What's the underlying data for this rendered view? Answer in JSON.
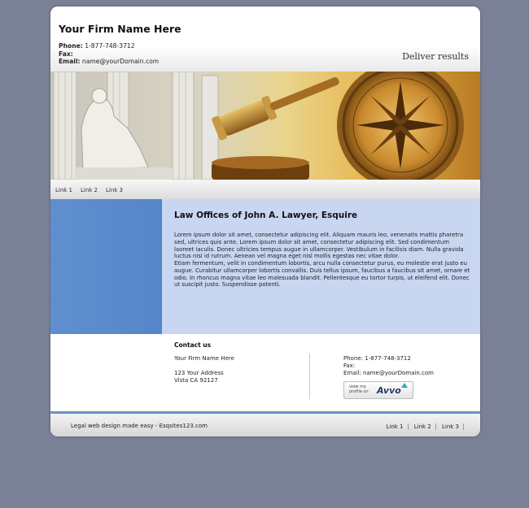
{
  "header": {
    "firm_name": "Your Firm Name Here",
    "phone_label": "Phone:",
    "phone_value": "1-877-748-3712",
    "fax_label": "Fax:",
    "email_label": "Email:",
    "email_value": "name@yourDomain.com",
    "tagline": "Deliver results"
  },
  "nav": {
    "links": [
      "Link 1",
      "Link 2",
      "Link 3"
    ]
  },
  "content": {
    "heading": "Law Offices of John A. Lawyer, Esquire",
    "paragraph1": "Lorem ipsum dolor sit amet, consectetur adipiscing elit. Aliquam mauris leo, venenatis mattis pharetra sed, ultrices quis ante. Lorem ipsum dolor sit amet, consectetur adipiscing elit. Sed condimentum laoreet iaculis. Donec ultricies tempus augue in ullamcorper. Vestibulum in facilisis diam. Nulla gravida luctus nisi id rutrum. Aenean vel magna eget nisl mollis egestas nec vitae dolor.",
    "paragraph2": "Etiam fermentum, velit in condimentum lobortis, arcu nulla consectetur purus, eu molestie erat justo eu augue. Curabitur ullamcorper lobortis convallis. Duis tellus ipsum, faucibus a faucibus sit amet, ornare et odio. In rhoncus magna vitae leo malesuada blandit. Pellentesque eu tortor turpis, ut eleifend elit. Donec ut suscipit justo. Suspendisse potenti."
  },
  "contact": {
    "title": "Contact us",
    "firm_name": "Your Firm Name Here",
    "address_line1": "123 Your Address",
    "address_line2": "Vista CA 92127",
    "phone": "Phone: 1-877-748-3712",
    "fax": "Fax:",
    "email": "Email: name@yourDomain.com",
    "avvo_small_line1": "view my",
    "avvo_small_line2": "profile on",
    "avvo_brand": "Avvo"
  },
  "footer": {
    "text": "Legal web design made easy - Esqsites123.com",
    "links": [
      "Link 1",
      "Link 2",
      "Link 3"
    ]
  },
  "colors": {
    "page_bg": "#7a8197",
    "content_bg": "#c9d6f2",
    "sidebar_blue": "#5486c9"
  }
}
